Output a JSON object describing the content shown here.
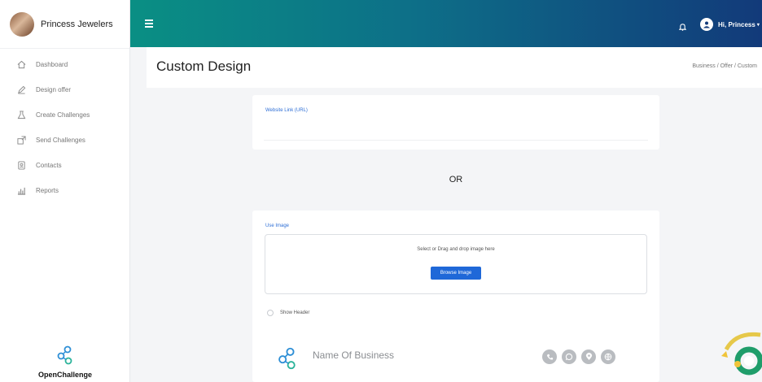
{
  "sidebar": {
    "brand": "Princess Jewelers",
    "items": [
      {
        "label": "Dashboard",
        "icon": "home-icon"
      },
      {
        "label": "Design offer",
        "icon": "pencil-icon"
      },
      {
        "label": "Create Challenges",
        "icon": "flask-icon"
      },
      {
        "label": "Send Challenges",
        "icon": "send-icon"
      },
      {
        "label": "Contacts",
        "icon": "contacts-icon"
      },
      {
        "label": "Reports",
        "icon": "chart-icon"
      }
    ],
    "logo_name": "OpenChallenge"
  },
  "topbar": {
    "user_label": "Hi, Princess"
  },
  "page": {
    "title": "Custom Design",
    "breadcrumb": "Business / Offer / Custom"
  },
  "website": {
    "label": "Website Link (URL)"
  },
  "or_text": "OR",
  "image": {
    "label": "Use Image",
    "drop_text": "Select or Drag and drop image here",
    "browse_label": "Browse Image"
  },
  "header": {
    "show_label": "Show Header",
    "business_name": "Name Of Business"
  },
  "colors": {
    "accent": "#1f68d8",
    "topbar_start": "#0a8f84",
    "topbar_end": "#123a7a"
  }
}
